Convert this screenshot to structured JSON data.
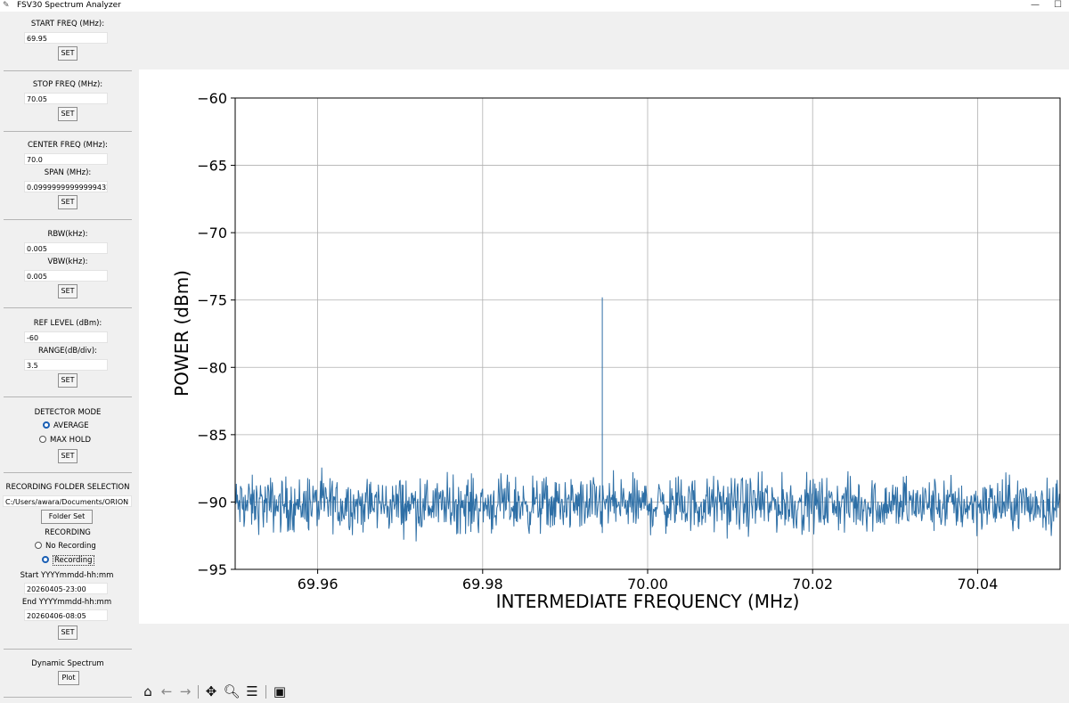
{
  "window": {
    "title": "FSV30 Spectrum Analyzer"
  },
  "sidebar": {
    "start_freq": {
      "label": "START FREQ (MHz):",
      "value": "69.95",
      "button": "SET"
    },
    "stop_freq": {
      "label": "STOP FREQ (MHz):",
      "value": "70.05",
      "button": "SET"
    },
    "center": {
      "center_label": "CENTER FREQ (MHz):",
      "center_value": "70.0",
      "span_label": "SPAN (MHz):",
      "span_value": "0.09999999999999432",
      "button": "SET"
    },
    "bandwidth": {
      "rbw_label": "RBW(kHz):",
      "rbw_value": "0.005",
      "vbw_label": "VBW(kHz):",
      "vbw_value": "0.005",
      "button": "SET"
    },
    "ref": {
      "ref_label": "REF LEVEL (dBm):",
      "ref_value": "-60",
      "range_label": "RANGE(dB/div):",
      "range_value": "3.5",
      "button": "SET"
    },
    "detector": {
      "label": "DETECTOR MODE",
      "options": [
        "AVERAGE",
        "MAX HOLD"
      ],
      "selected": "AVERAGE",
      "button": "SET"
    },
    "recording": {
      "folder_label": "RECORDING FOLDER SELECTION",
      "folder_path": "C:/Users/awara/Documents/ORION",
      "folder_button": "Folder Set",
      "recording_label": "RECORDING",
      "options": [
        "No Recording",
        "Recording"
      ],
      "selected": "Recording",
      "start_label": "Start YYYYmmdd-hh:mm",
      "start_value": "20260405-23:00",
      "end_label": "End YYYYmmdd-hh:mm",
      "end_value": "20260406-08:05",
      "button": "SET"
    },
    "dynamic": {
      "label": "Dynamic Spectrum",
      "button": "Plot"
    }
  },
  "toolbar": {
    "icons": [
      "home-icon",
      "back-icon",
      "forward-icon",
      "pan-icon",
      "zoom-icon",
      "configure-icon",
      "save-icon"
    ]
  },
  "chart_data": {
    "type": "line",
    "title": "",
    "xlabel": "INTERMEDIATE FREQUENCY (MHz)",
    "ylabel": "POWER (dBm)",
    "xlim": [
      69.95,
      70.05
    ],
    "ylim": [
      -95,
      -60
    ],
    "xticks": [
      69.96,
      69.98,
      70.0,
      70.02,
      70.04
    ],
    "xtick_labels": [
      "69.96",
      "69.98",
      "70.00",
      "70.02",
      "70.04"
    ],
    "yticks": [
      -60,
      -65,
      -70,
      -75,
      -80,
      -85,
      -90,
      -95
    ],
    "ytick_labels": [
      "−60",
      "−65",
      "−70",
      "−75",
      "−80",
      "−85",
      "−90",
      "−95"
    ],
    "grid": true,
    "line_color": "#2e6fa6",
    "series": [
      {
        "noise_floor_dbm": -90.2,
        "noise_peak_to_peak_db": 3.2,
        "peaks": [
          {
            "x": 69.9945,
            "y": -74.8
          }
        ],
        "x": [
          69.95,
          69.955,
          69.96,
          69.965,
          69.97,
          69.975,
          69.98,
          69.985,
          69.99,
          69.9945,
          70.0,
          70.005,
          70.01,
          70.015,
          70.02,
          70.025,
          70.03,
          70.035,
          70.04,
          70.045,
          70.05
        ],
        "y": [
          -90.3,
          -90.1,
          -90.4,
          -90.0,
          -90.2,
          -90.1,
          -90.3,
          -90.2,
          -90.0,
          -74.8,
          -90.2,
          -90.1,
          -90.3,
          -90.2,
          -90.0,
          -90.3,
          -90.2,
          -90.1,
          -90.2,
          -90.3,
          -90.1
        ]
      }
    ]
  }
}
